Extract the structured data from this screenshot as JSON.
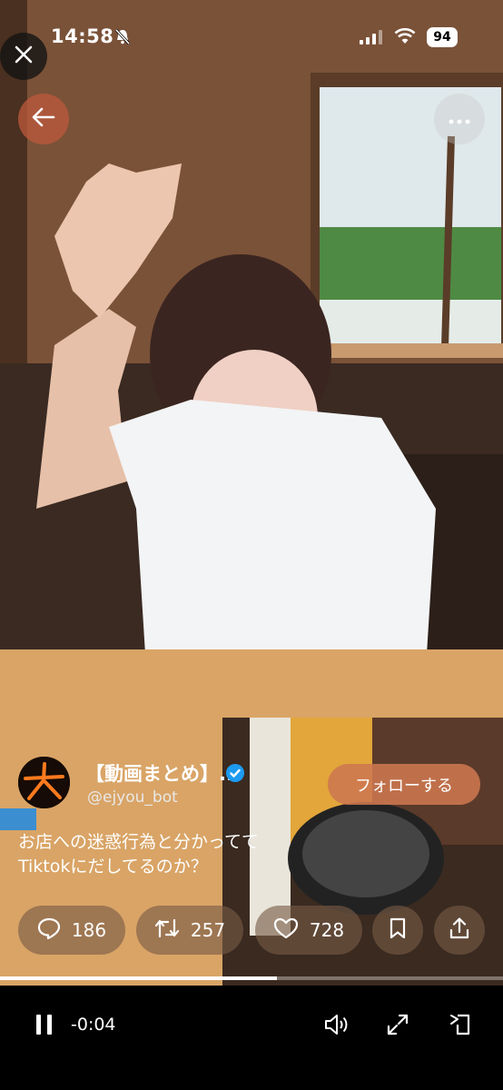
{
  "status_bar": {
    "time": "14:58",
    "battery": "94"
  },
  "tweet": {
    "display_name": "【動画まとめ】...",
    "handle": "@ejyou_bot",
    "follow_label": "フォローする",
    "text_line1": "お店への迷惑行為と分かってて",
    "text_line2": "Tiktokにだしてるのか？"
  },
  "actions": {
    "replies": "186",
    "retweets": "257",
    "likes": "728"
  },
  "player": {
    "remaining": "-0:04",
    "progress": 0.55
  },
  "icons": [
    "close-icon",
    "back-arrow-icon",
    "more-icon",
    "bell-muted-icon",
    "signal-icon",
    "wifi-icon",
    "verified-icon",
    "reply-icon",
    "retweet-icon",
    "like-icon",
    "bookmark-icon",
    "share-icon",
    "pause-icon",
    "volume-icon",
    "expand-icon",
    "rotate-icon"
  ],
  "colors": {
    "follow_bg": "#cd7850",
    "verified": "#1d9bf0"
  }
}
